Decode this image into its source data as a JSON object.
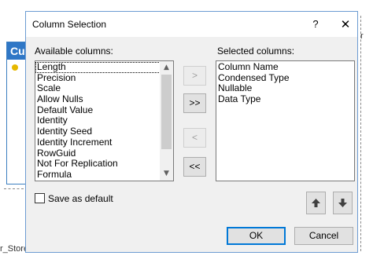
{
  "background": {
    "table_header": "Cu",
    "store_label": "r_Store",
    "right_edge_text": "r"
  },
  "dialog": {
    "title": "Column Selection",
    "help_label": "?",
    "close_label": "✕",
    "available_label": "Available columns:",
    "selected_label": "Selected columns:",
    "available_columns": [
      "Length",
      "Precision",
      "Scale",
      "Allow Nulls",
      "Default Value",
      "Identity",
      "Identity Seed",
      "Identity Increment",
      "RowGuid",
      "Not For Replication",
      "Formula"
    ],
    "selected_columns": [
      "Column Name",
      "Condensed Type",
      "Nullable",
      "Data Type"
    ],
    "add_label": ">",
    "add_all_label": ">>",
    "remove_label": "<",
    "remove_all_label": "<<",
    "save_default_label": "Save as default",
    "save_default_checked": false,
    "ok_label": "OK",
    "cancel_label": "Cancel",
    "move_up_icon": "arrow-up-icon",
    "move_down_icon": "arrow-down-icon"
  },
  "colors": {
    "accent": "#0078d7",
    "table_header_bg": "#2f77c6"
  }
}
